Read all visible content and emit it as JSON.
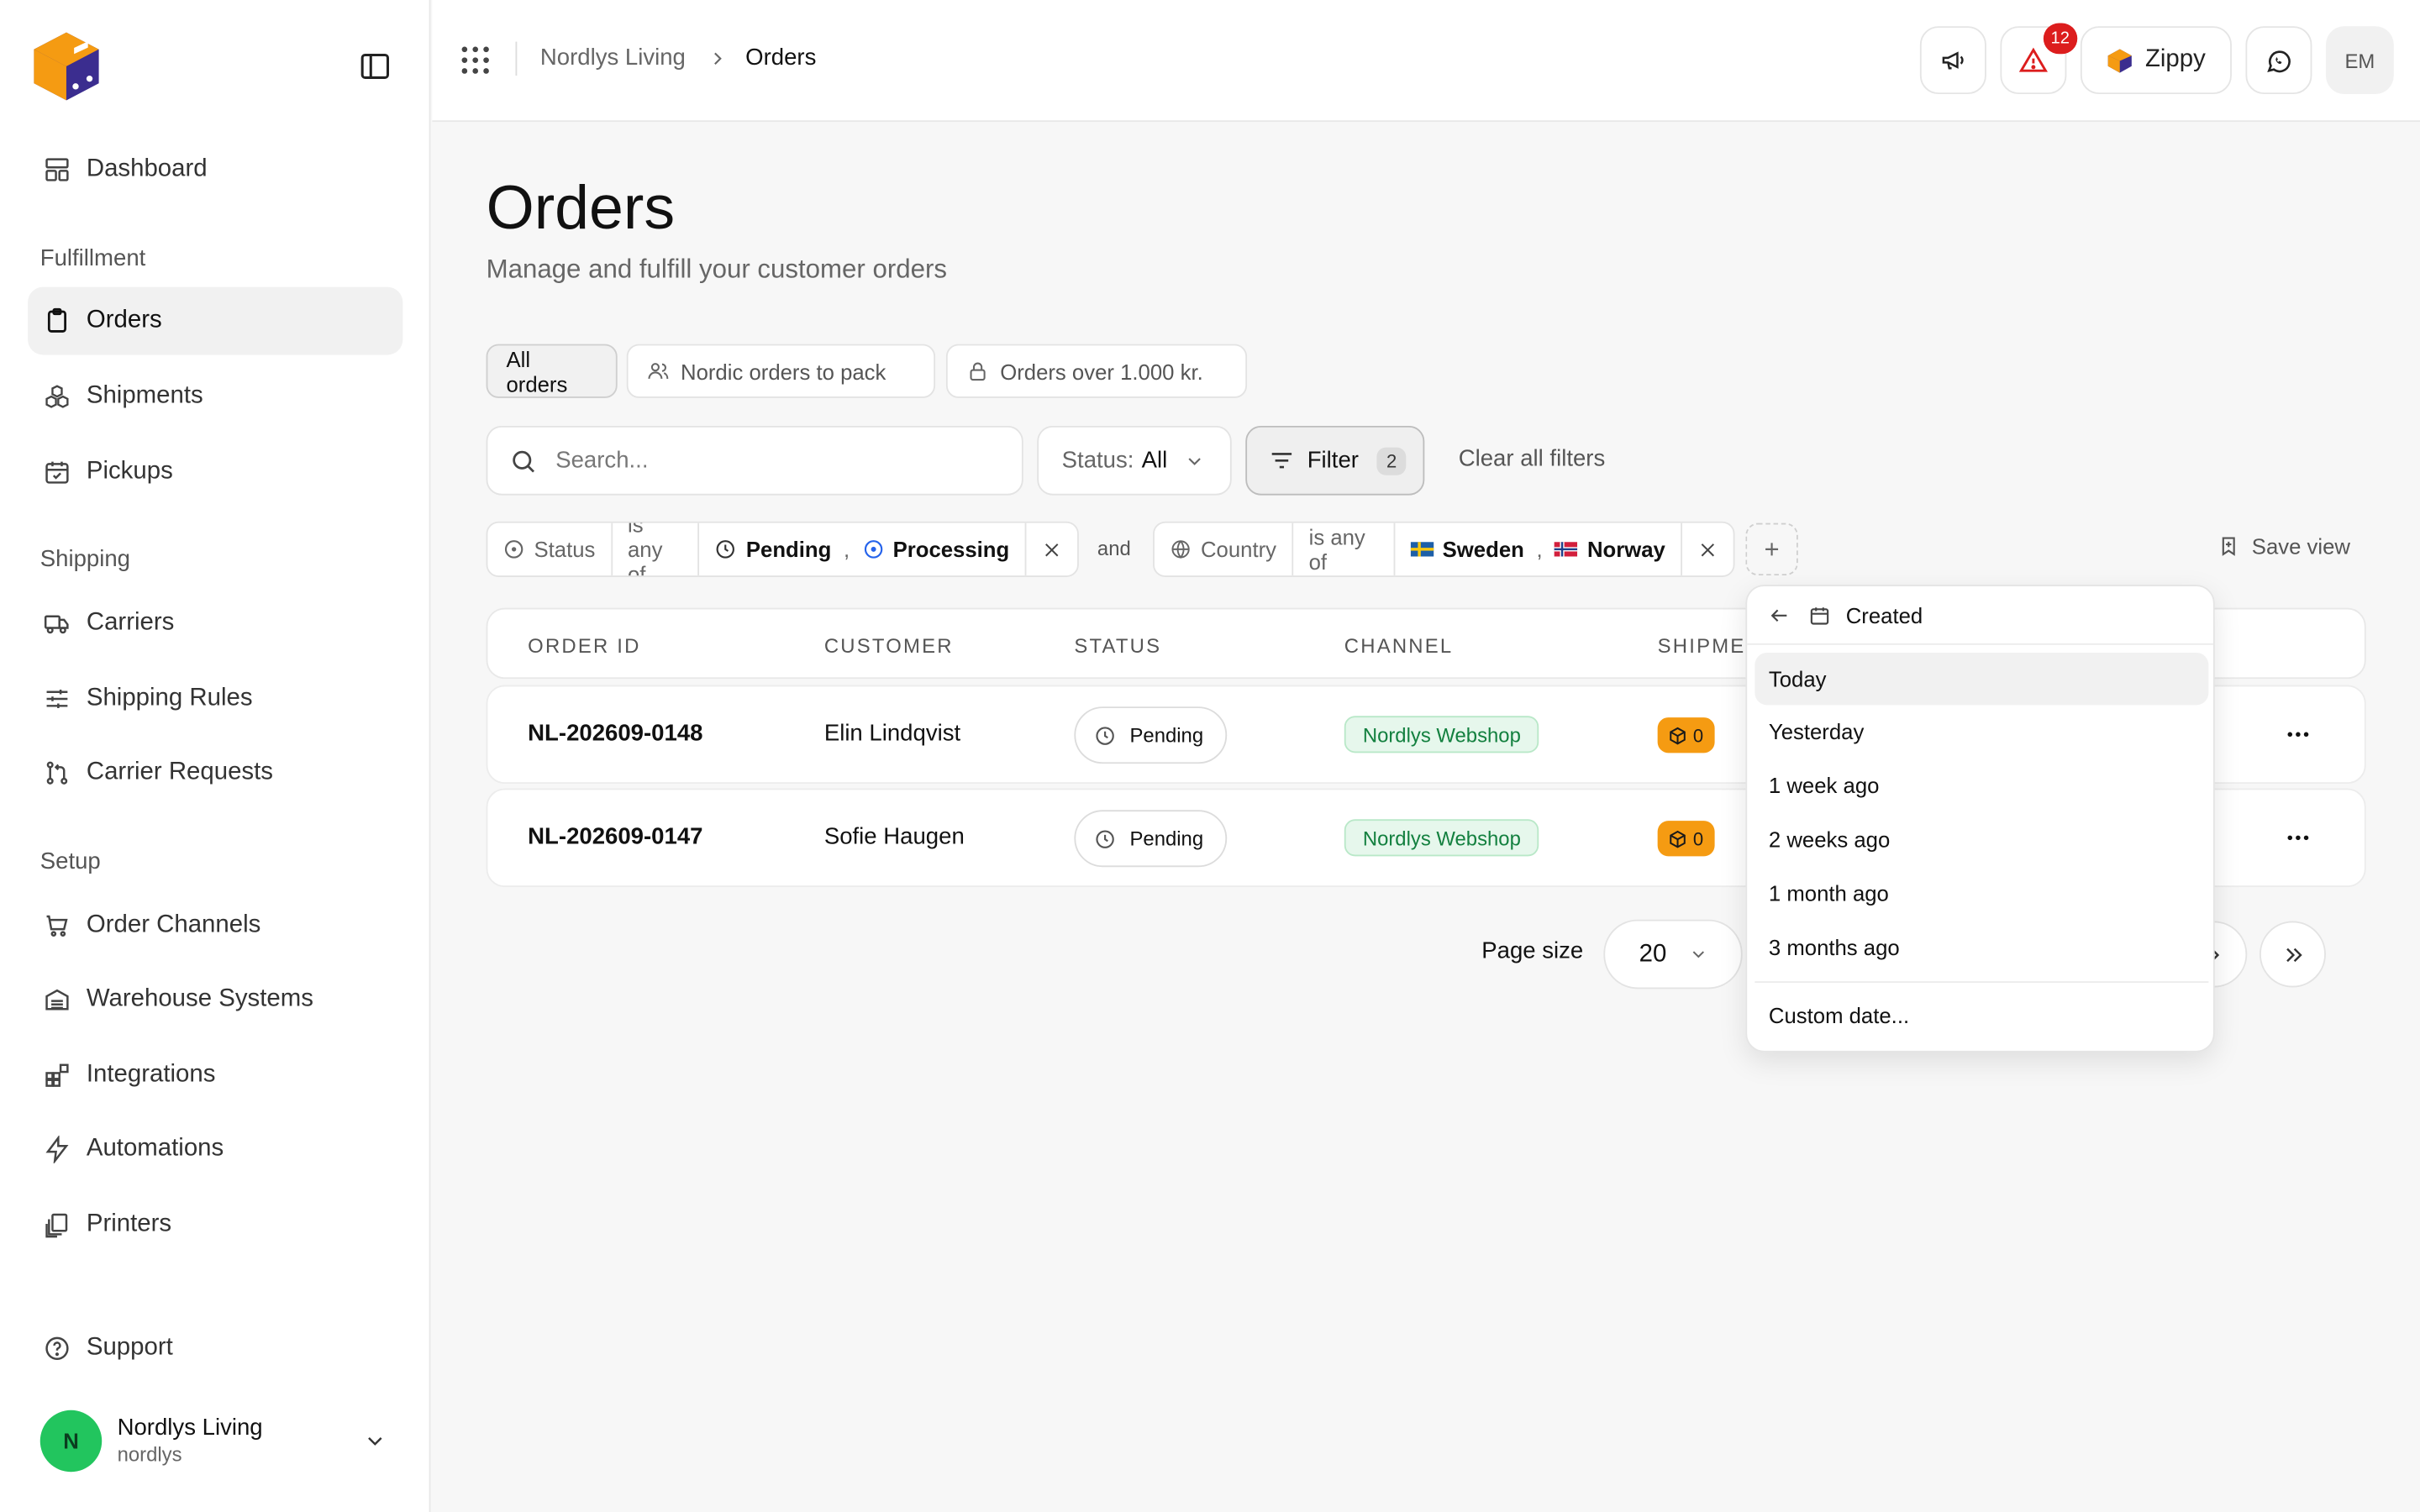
{
  "sidebar": {
    "nav": {
      "dashboard": "Dashboard",
      "section_fulfillment": "Fulfillment",
      "orders": "Orders",
      "shipments": "Shipments",
      "pickups": "Pickups",
      "section_shipping": "Shipping",
      "carriers": "Carriers",
      "shipping_rules": "Shipping Rules",
      "carrier_requests": "Carrier Requests",
      "section_setup": "Setup",
      "order_channels": "Order Channels",
      "warehouse_systems": "Warehouse Systems",
      "integrations": "Integrations",
      "automations": "Automations",
      "printers": "Printers",
      "support": "Support"
    },
    "account": {
      "initial": "N",
      "name": "Nordlys Living",
      "handle": "nordlys",
      "avatar_color": "#22c55e"
    }
  },
  "header": {
    "breadcrumb": [
      "Nordlys Living",
      "Orders"
    ],
    "alerts_count": "12",
    "zippy_label": "Zippy",
    "user_initials": "EM"
  },
  "page": {
    "title": "Orders",
    "subtitle": "Manage and fulfill your customer orders"
  },
  "views": {
    "all": "All orders",
    "nordic": "Nordic orders to pack",
    "over": "Orders over 1.000 kr."
  },
  "toolbar": {
    "search_placeholder": "Search...",
    "status_label": "Status:",
    "status_value": "All",
    "filter_label": "Filter",
    "filter_count": "2",
    "clear_label": "Clear all filters"
  },
  "filters": {
    "status": {
      "field": "Status",
      "op": "is any of",
      "v1": "Pending",
      "v2": "Processing"
    },
    "joiner": "and",
    "country": {
      "field": "Country",
      "op": "is any of",
      "v1": "Sweden",
      "v2": "Norway"
    },
    "comma": ",",
    "save_view": "Save view"
  },
  "table": {
    "headers": {
      "order_id": "ORDER ID",
      "customer": "CUSTOMER",
      "status": "STATUS",
      "channel": "CHANNEL",
      "shipments": "SHIPME"
    },
    "rows": [
      {
        "id": "NL-202609-0148",
        "customer": "Elin Lindqvist",
        "status": "Pending",
        "channel": "Nordlys Webshop",
        "shipments": "0"
      },
      {
        "id": "NL-202609-0147",
        "customer": "Sofie Haugen",
        "status": "Pending",
        "channel": "Nordlys Webshop",
        "shipments": "0"
      }
    ]
  },
  "pagination": {
    "page_size_label": "Page size",
    "page_size_value": "20"
  },
  "date_menu": {
    "title": "Created",
    "options": [
      "Today",
      "Yesterday",
      "1 week ago",
      "2 weeks ago",
      "1 month ago",
      "3 months ago"
    ],
    "custom": "Custom date..."
  },
  "colors": {
    "accent_channel": "#13803f",
    "shipment_badge": "#f59b12",
    "alert_badge": "#dc1d1d"
  }
}
